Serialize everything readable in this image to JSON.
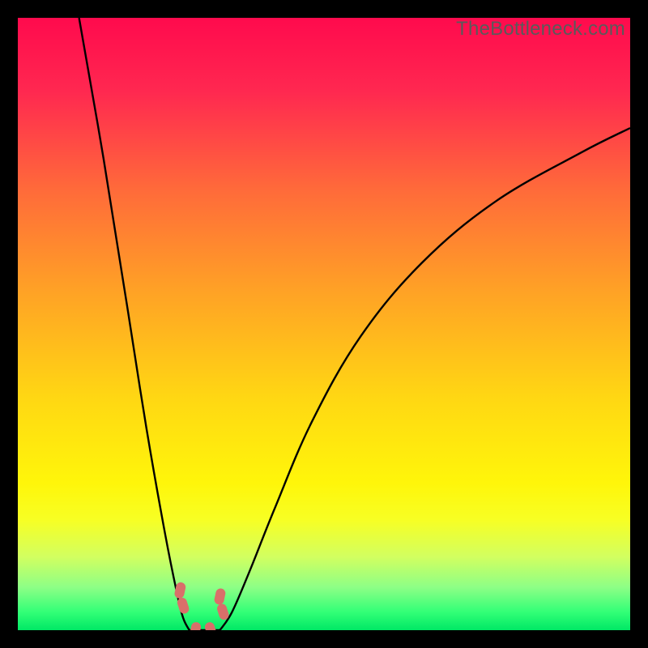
{
  "watermark": "TheBottleneck.com",
  "chart_data": {
    "type": "line",
    "title": "",
    "xlabel": "",
    "ylabel": "",
    "xlim": [
      0,
      100
    ],
    "ylim": [
      0,
      100
    ],
    "curve_left": {
      "description": "Left falling branch of V-shape",
      "x": [
        10,
        14,
        18,
        21,
        24,
        26,
        27,
        28
      ],
      "y": [
        100,
        77,
        52,
        33,
        16,
        6,
        2,
        0
      ]
    },
    "curve_right": {
      "description": "Right rising branch of V-shape",
      "x": [
        33,
        35,
        38,
        42,
        48,
        56,
        66,
        78,
        92,
        100
      ],
      "y": [
        0,
        3,
        10,
        20,
        34,
        48,
        60,
        70,
        78,
        82
      ]
    },
    "floor_segment": {
      "x": [
        28,
        33
      ],
      "y": [
        0,
        0
      ]
    },
    "markers": [
      {
        "x": 26.5,
        "y": 6.5
      },
      {
        "x": 27.0,
        "y": 4.0
      },
      {
        "x": 33.0,
        "y": 5.5
      },
      {
        "x": 33.5,
        "y": 3.0
      },
      {
        "x": 29.0,
        "y": 0.0
      },
      {
        "x": 31.5,
        "y": 0.0
      }
    ],
    "gradient_stops": [
      {
        "offset": 0.0,
        "color": "#ff0a4d"
      },
      {
        "offset": 0.12,
        "color": "#ff2850"
      },
      {
        "offset": 0.28,
        "color": "#ff6a3a"
      },
      {
        "offset": 0.45,
        "color": "#ffa325"
      },
      {
        "offset": 0.62,
        "color": "#ffd713"
      },
      {
        "offset": 0.76,
        "color": "#fff60a"
      },
      {
        "offset": 0.82,
        "color": "#f7ff24"
      },
      {
        "offset": 0.88,
        "color": "#d2ff60"
      },
      {
        "offset": 0.93,
        "color": "#8dff86"
      },
      {
        "offset": 0.97,
        "color": "#33ff77"
      },
      {
        "offset": 1.0,
        "color": "#00e865"
      }
    ],
    "marker_color": "#d96f6a",
    "curve_color": "#000000"
  }
}
